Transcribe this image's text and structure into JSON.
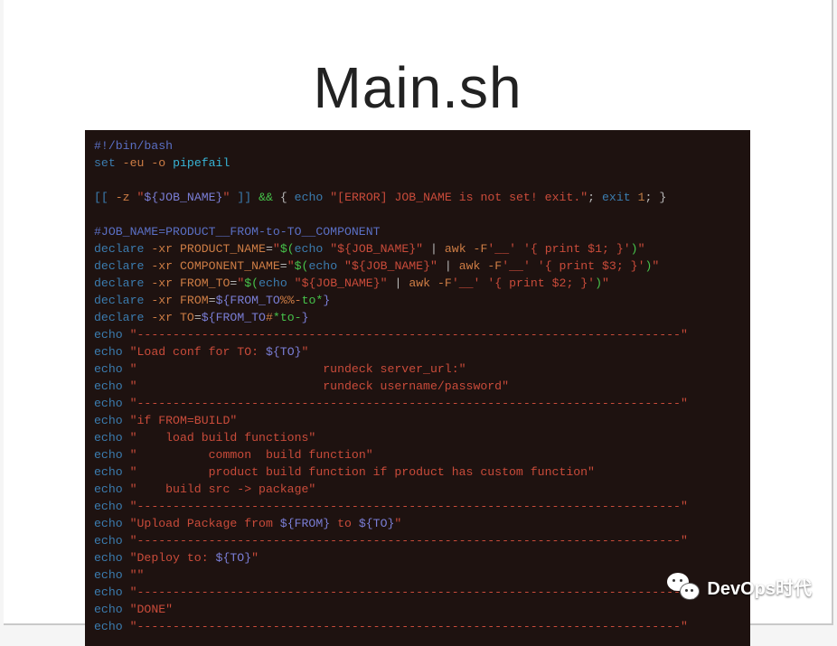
{
  "title": "Main.sh",
  "watermark": {
    "text": "DevOps时代"
  },
  "code": {
    "l1": {
      "comment": "#!/bin/bash"
    },
    "l2": {
      "cmd": "set",
      "flags": "-eu -o",
      "kw": "pipefail"
    },
    "l3": {},
    "l4": {
      "test_open": "[[",
      "flag": "-z",
      "q1": "\"",
      "var": "${JOB_NAME}",
      "q2": "\"",
      "test_close": "]]",
      "and": "&&",
      "brace_o": "{",
      "echo": "echo",
      "str": "\"[ERROR] JOB_NAME is not set! exit.\"",
      "semi1": ";",
      "exit": "exit",
      "code1": "1",
      "semi2": ";",
      "brace_c": "}"
    },
    "l5": {},
    "l6": {
      "comment": "#JOB_NAME=PRODUCT__FROM-to-TO__COMPONENT"
    },
    "l7": {
      "decl": "declare",
      "flags": "-xr",
      "var": "PRODUCT_NAME",
      "eq": "=",
      "q1": "\"",
      "sub_o": "$(",
      "echo": "echo",
      "str": "\"${JOB_NAME}\"",
      "pipe": "|",
      "awk": "awk",
      "f": "-F",
      "fs": "'__'",
      "prog": "'{ print $1; }'",
      "sub_c": ")",
      "q2": "\""
    },
    "l8": {
      "decl": "declare",
      "flags": "-xr",
      "var": "COMPONENT_NAME",
      "eq": "=",
      "q1": "\"",
      "sub_o": "$(",
      "echo": "echo",
      "str": "\"${JOB_NAME}\"",
      "pipe": "|",
      "awk": "awk",
      "f": "-F",
      "fs": "'__'",
      "prog": "'{ print $3; }'",
      "sub_c": ")",
      "q2": "\""
    },
    "l9": {
      "decl": "declare",
      "flags": "-xr",
      "var": "FROM_TO",
      "eq": "=",
      "q1": "\"",
      "sub_o": "$(",
      "echo": "echo",
      "str": "\"${JOB_NAME}\"",
      "pipe": "|",
      "awk": "awk",
      "f": "-F",
      "fs": "'__'",
      "prog": "'{ print $2; }'",
      "sub_c": ")",
      "q2": "\""
    },
    "l10": {
      "decl": "declare",
      "flags": "-xr",
      "var": "FROM",
      "eq": "=",
      "exp_o": "${",
      "name": "FROM_TO",
      "op": "%%-",
      "pat": "to*",
      "exp_c": "}"
    },
    "l11": {
      "decl": "declare",
      "flags": "-xr",
      "var": "TO",
      "eq": "=",
      "exp_o": "${",
      "name": "FROM_TO",
      "op": "#",
      "pat": "*to-",
      "exp_c": "}"
    },
    "l12": {
      "echo": "echo",
      "str": "\"----------------------------------------------------------------------------\""
    },
    "l13": {
      "echo": "echo",
      "pre": "\"Load conf for TO: ",
      "var": "${TO}",
      "post": "\""
    },
    "l14": {
      "echo": "echo",
      "str": "\"                          rundeck server_url:\""
    },
    "l15": {
      "echo": "echo",
      "str": "\"                          rundeck username/password\""
    },
    "l16": {
      "echo": "echo",
      "str": "\"----------------------------------------------------------------------------\""
    },
    "l17": {
      "echo": "echo",
      "str": "\"if FROM=BUILD\""
    },
    "l18": {
      "echo": "echo",
      "str": "\"    load build functions\""
    },
    "l19": {
      "echo": "echo",
      "str": "\"          common  build function\""
    },
    "l20": {
      "echo": "echo",
      "str": "\"          product build function if product has custom function\""
    },
    "l21": {
      "echo": "echo",
      "str": "\"    build src -> package\""
    },
    "l22": {
      "echo": "echo",
      "str": "\"----------------------------------------------------------------------------\""
    },
    "l23": {
      "echo": "echo",
      "pre": "\"Upload Package from ",
      "var1": "${FROM}",
      "mid": " to ",
      "var2": "${TO}",
      "post": "\""
    },
    "l24": {
      "echo": "echo",
      "str": "\"----------------------------------------------------------------------------\""
    },
    "l25": {
      "echo": "echo",
      "pre": "\"Deploy to: ",
      "var": "${TO}",
      "post": "\""
    },
    "l26": {
      "echo": "echo",
      "str": "\"\""
    },
    "l27": {
      "echo": "echo",
      "str": "\"----------------------------------------------------------------------------\""
    },
    "l28": {
      "echo": "echo",
      "str": "\"DONE\""
    },
    "l29": {
      "echo": "echo",
      "str": "\"----------------------------------------------------------------------------\""
    }
  }
}
